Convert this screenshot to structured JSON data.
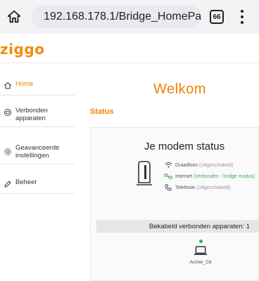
{
  "browser": {
    "url": "192.168.178.1/Bridge_HomePa",
    "tab_count": "66",
    "icons": {
      "home": "home-icon",
      "warning": "warning-icon",
      "menu": "more-vert-icon"
    }
  },
  "header": {
    "logo_text": "ziggo"
  },
  "sidebar": {
    "items": [
      {
        "label": "Home",
        "icon": "home-icon",
        "active": true
      },
      {
        "label": "Verbonden apparaten",
        "icon": "devices-icon",
        "active": false
      },
      {
        "label": "Geavanceerde instellingen",
        "icon": "gear-icon",
        "active": false
      },
      {
        "label": "Beheer",
        "icon": "pencil-icon",
        "active": false
      }
    ]
  },
  "main": {
    "welcome": "Welkom",
    "status_heading": "Status",
    "card": {
      "title": "Je modem status",
      "lines": [
        {
          "name": "Draadloos",
          "state": "(Uitgeschakeld)",
          "icon": "wifi-icon",
          "ok": false
        },
        {
          "name": "Internet",
          "state": "(Verbonden - bridge modus)",
          "icon": "internet-icon",
          "ok": true
        },
        {
          "name": "Telefonie",
          "state": "(Uitgeschakeld)",
          "icon": "phone-icon",
          "ok": false
        }
      ],
      "wired_label": "Bekabeld verbonden apparaten: 1",
      "device": {
        "name": "Archer_C8",
        "icon": "laptop-icon",
        "status_color": "#35b34a"
      }
    }
  },
  "colors": {
    "accent": "#f08200",
    "ok": "#4aa84a"
  }
}
